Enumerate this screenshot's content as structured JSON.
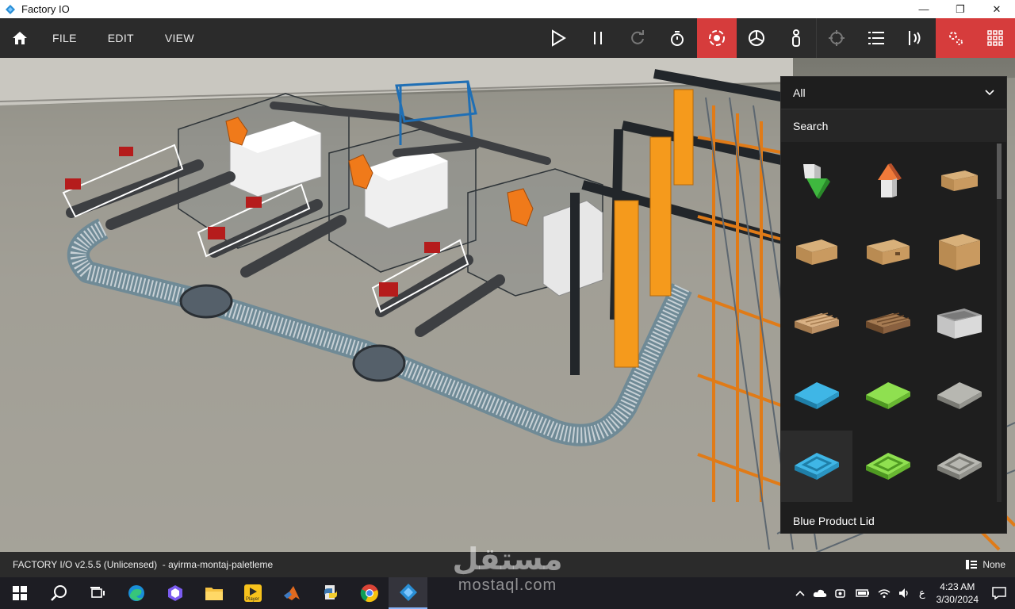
{
  "window": {
    "title": "Factory IO",
    "minimize_glyph": "—",
    "restore_glyph": "❐",
    "close_glyph": "✕"
  },
  "menu": {
    "items": [
      "FILE",
      "EDIT",
      "VIEW"
    ]
  },
  "toolbar": {
    "tools": [
      {
        "name": "play-icon",
        "active": false
      },
      {
        "name": "pause-icon",
        "active": false
      },
      {
        "name": "reset-icon",
        "active": false
      },
      {
        "name": "stopwatch-icon",
        "active": false
      },
      {
        "name": "orbit-camera-icon",
        "active": true
      },
      {
        "name": "fly-camera-icon",
        "active": false
      },
      {
        "name": "first-person-icon",
        "active": false
      },
      {
        "name": "crosshair-icon",
        "active": false
      },
      {
        "name": "list-icon",
        "active": false
      },
      {
        "name": "sensor-icon",
        "active": false
      },
      {
        "name": "gear-icon",
        "active": true
      },
      {
        "name": "grid-icon",
        "active": true
      }
    ],
    "accent_color": "#d63c3c"
  },
  "palette": {
    "filter_value": "All",
    "search_label": "Search",
    "selected_item_label": "Blue Product Lid",
    "items": [
      {
        "name": "remover-icon"
      },
      {
        "name": "emitter-icon"
      },
      {
        "name": "small-box-icon"
      },
      {
        "name": "medium-box-icon"
      },
      {
        "name": "box-icon"
      },
      {
        "name": "large-box-icon"
      },
      {
        "name": "pallet-icon"
      },
      {
        "name": "stacked-pallet-icon"
      },
      {
        "name": "plastic-crate-icon"
      },
      {
        "name": "blue-raw-material-icon"
      },
      {
        "name": "green-raw-material-icon"
      },
      {
        "name": "metal-raw-material-icon"
      },
      {
        "name": "blue-product-lid-icon"
      },
      {
        "name": "green-product-lid-icon"
      },
      {
        "name": "metal-product-lid-icon"
      }
    ]
  },
  "status": {
    "text": "FACTORY I/O v2.5.5 (Unlicensed)  - ayirma-montaj-paletleme",
    "right_label": "None"
  },
  "taskbar": {
    "apps": [
      "start-icon",
      "search-icon",
      "task-view-icon",
      "edge-icon",
      "copilot-icon",
      "file-explorer-icon",
      "player-icon",
      "matlab-icon",
      "python-icon",
      "chrome-icon",
      "factory-io-icon"
    ],
    "player_label": "Player",
    "keyboard_lang": "ع",
    "time": "4:23 AM",
    "date": "3/30/2024"
  },
  "watermark": {
    "arabic": "مستقل",
    "latin": "mostaql.com"
  }
}
